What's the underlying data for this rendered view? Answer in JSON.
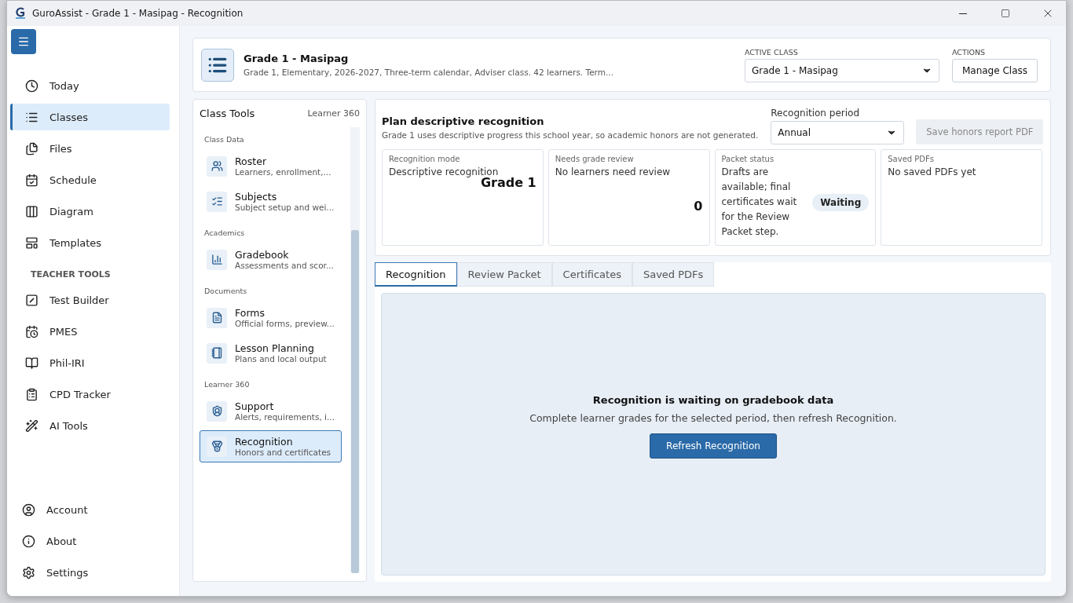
{
  "window": {
    "title": "GuroAssist - Grade 1 - Masipag - Recognition"
  },
  "sidebar": {
    "main_items": [
      {
        "label": "Today",
        "selected": false
      },
      {
        "label": "Classes",
        "selected": true
      },
      {
        "label": "Files",
        "selected": false
      },
      {
        "label": "Schedule",
        "selected": false
      },
      {
        "label": "Diagram",
        "selected": false
      },
      {
        "label": "Templates",
        "selected": false
      }
    ],
    "section_heading": "TEACHER TOOLS",
    "tool_items": [
      {
        "label": "Test Builder",
        "selected": false
      },
      {
        "label": "PMES",
        "selected": false
      },
      {
        "label": "Phil-IRI",
        "selected": false
      },
      {
        "label": "CPD Tracker",
        "selected": false
      },
      {
        "label": "AI Tools",
        "selected": false
      }
    ],
    "footer_items": [
      {
        "label": "Account"
      },
      {
        "label": "About"
      },
      {
        "label": "Settings"
      }
    ]
  },
  "class_header": {
    "title": "Grade 1 - Masipag",
    "subtitle": "Grade 1, Elementary, 2026-2027, Three-term calendar, Adviser class. 42 learners. Term...",
    "active_class_label": "ACTIVE CLASS",
    "active_class_value": "Grade 1 - Masipag",
    "actions_label": "ACTIONS",
    "manage_button": "Manage Class"
  },
  "class_tools": {
    "title": "Class Tools",
    "badge": "Learner 360",
    "groups": [
      {
        "heading": "Class Data",
        "items": [
          {
            "title": "Roster",
            "subtitle": "Learners, enrollment,...",
            "selected": false
          },
          {
            "title": "Subjects",
            "subtitle": "Subject setup and wei...",
            "selected": false
          }
        ]
      },
      {
        "heading": "Academics",
        "items": [
          {
            "title": "Gradebook",
            "subtitle": "Assessments and scor...",
            "selected": false
          }
        ]
      },
      {
        "heading": "Documents",
        "items": [
          {
            "title": "Forms",
            "subtitle": "Official forms, preview...",
            "selected": false
          },
          {
            "title": "Lesson Planning",
            "subtitle": "Plans and local output",
            "selected": false
          }
        ]
      },
      {
        "heading": "Learner 360",
        "items": [
          {
            "title": "Support",
            "subtitle": "Alerts, requirements, i...",
            "selected": false
          },
          {
            "title": "Recognition",
            "subtitle": "Honors and certificates",
            "selected": true
          }
        ]
      }
    ]
  },
  "recognition": {
    "title": "Plan descriptive recognition",
    "description": "Grade 1 uses descriptive progress this school year, so academic honors are not generated.",
    "period_label": "Recognition period",
    "period_value": "Annual",
    "save_button": {
      "label": "Save honors report PDF",
      "disabled": true
    },
    "stats": [
      {
        "kind": "value",
        "label": "Recognition mode",
        "text": "Descriptive recognition",
        "value": "Grade 1"
      },
      {
        "kind": "value",
        "label": "Needs grade review",
        "text": "No learners need review",
        "value": "0"
      },
      {
        "kind": "badge",
        "label": "Packet status",
        "text": "Drafts are available; final certificates wait for the Review Packet step.",
        "value": "Waiting"
      },
      {
        "kind": "text",
        "label": "Saved PDFs",
        "text": "No saved PDFs yet"
      }
    ],
    "tabs": [
      {
        "label": "Recognition",
        "selected": true
      },
      {
        "label": "Review Packet",
        "selected": false
      },
      {
        "label": "Certificates",
        "selected": false
      },
      {
        "label": "Saved PDFs",
        "selected": false
      }
    ],
    "empty_state": {
      "title": "Recognition is waiting on gradebook data",
      "message": "Complete learner grades for the selected period, then refresh Recognition.",
      "button": "Refresh Recognition"
    }
  }
}
